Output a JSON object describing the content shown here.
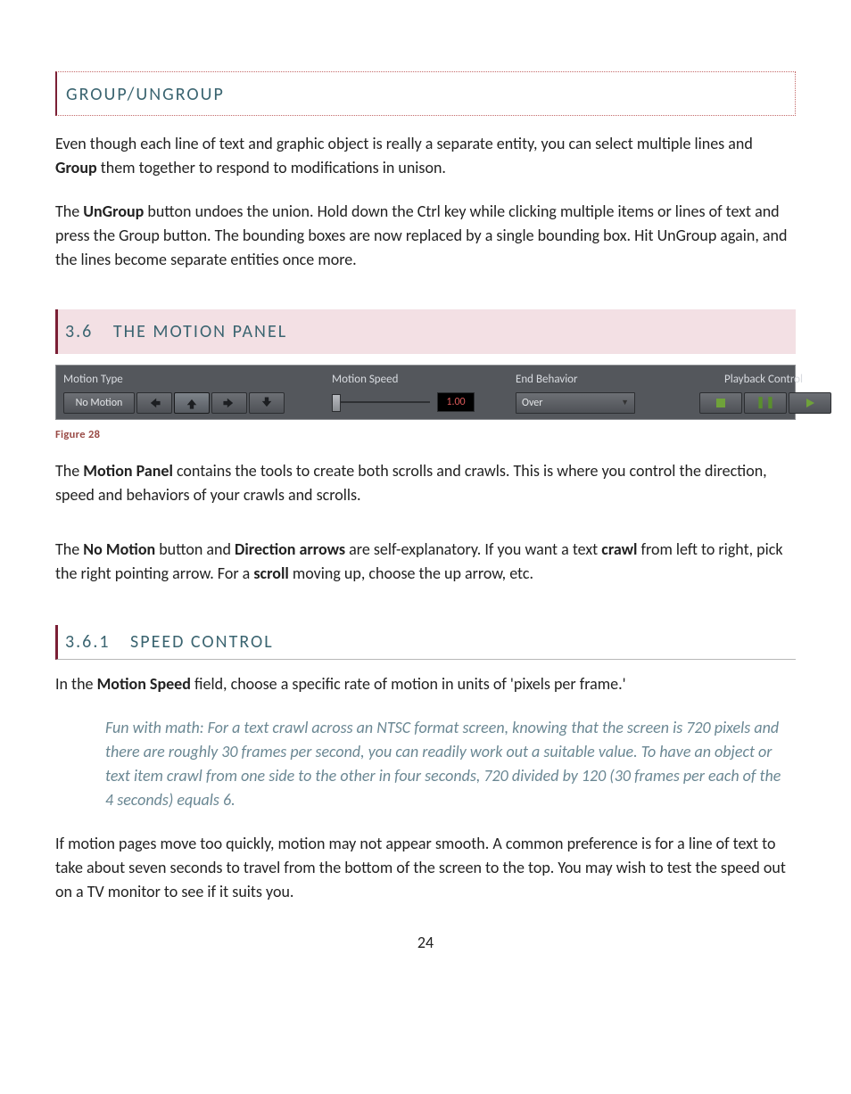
{
  "group_box": {
    "title": "GROUP/UNGROUP",
    "p1a": " Even though each line of text and graphic object is really a separate entity, you can select multiple lines and ",
    "p1b": "Group",
    "p1c": " them together to respond to modifications in unison.",
    "p2a": "The ",
    "p2b": "UnGroup",
    "p2c": " button undoes the union. Hold down the Ctrl key while clicking multiple items or lines of text and press the Group button. The bounding boxes are now replaced by a single bounding box. Hit UnGroup again, and the lines become separate entities once more."
  },
  "section": {
    "num": "3.6",
    "title": "THE MOTION PANEL"
  },
  "panel": {
    "motion_type_label": "Motion Type",
    "motion_speed_label": "Motion Speed",
    "end_behavior_label": "End Behavior",
    "playback_label": "Playback Control",
    "no_motion": "No Motion",
    "speed_value": "1.00",
    "end_behavior_value": "Over"
  },
  "caption": "Figure 28",
  "para_mp_a": "The ",
  "para_mp_b": "Motion Panel",
  "para_mp_c": " contains the tools to create both scrolls and crawls.  This is where you control the direction, speed and behaviors of your crawls and scrolls.",
  "para_nm_a": "The ",
  "para_nm_b": "No Motion",
  "para_nm_c": " button and ",
  "para_nm_d": "Direction arrows",
  "para_nm_e": " are self-explanatory. If you want a text ",
  "para_nm_f": "crawl",
  "para_nm_g": " from left to right, pick the right pointing arrow. For a ",
  "para_nm_h": "scroll",
  "para_nm_i": " moving up, choose the up arrow, etc.",
  "subsection": {
    "num": "3.6.1",
    "title": "SPEED CONTROL"
  },
  "speed_p_a": "In the ",
  "speed_p_b": "Motion Speed",
  "speed_p_c": " field, choose a specific rate of motion in units of 'pixels per frame.'",
  "tip": "Fun with math: For a text crawl across an NTSC format screen, knowing that the screen is 720 pixels and there are roughly 30 frames per second, you can readily work out a suitable value.  To have an object or text item crawl from one side to the other in four seconds, 720 divided by 120 (30 frames per each of the 4 seconds) equals 6.",
  "closing": "If motion pages move too quickly, motion may not appear smooth. A common preference is for a line of text to take about seven seconds to travel from the bottom of the screen to the top. You may wish to test the speed out on a TV monitor to see if it suits you.",
  "page_number": "24"
}
